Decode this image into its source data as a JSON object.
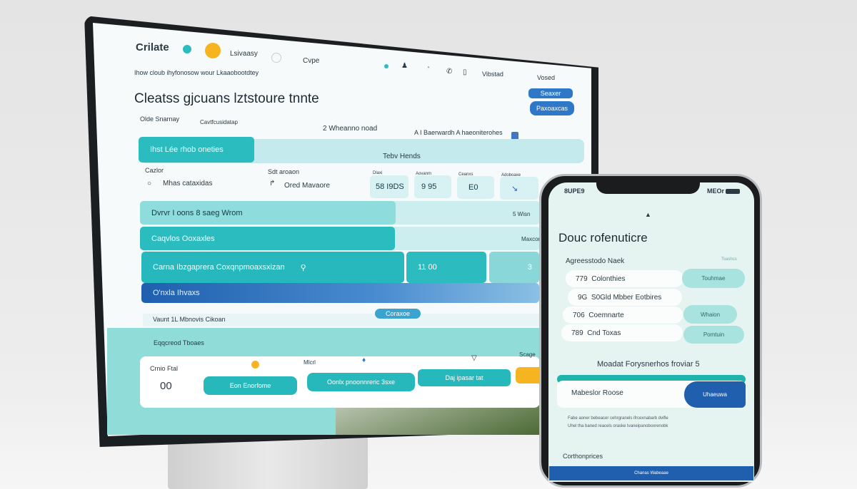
{
  "monitor": {
    "header": {
      "app_name": "Crilate",
      "nav": [
        "Lsivaasy",
        "Cvpe"
      ],
      "right": [
        "Vibstad",
        "Vosed"
      ]
    },
    "breadcrumb": "Ihow cloub ihyfonosow wour Lkaaobootdtey",
    "title": "Cleatss gjcuans lztstoure tnnte",
    "buttons": [
      "Seaxer",
      "Paxoaxcas"
    ],
    "meta": [
      "Olde Snarnay",
      "Cavtfcusidatap",
      "2 Wheanno noad",
      "A I Baerwardh A haeoniterohes"
    ],
    "tabs": [
      "Ihst Lée rhob oneties",
      "Tebv Hends"
    ],
    "labels": [
      "Cazlor",
      "Sdt aroaon"
    ],
    "items": [
      "Mhas cataxidas",
      "Ored Mavaore"
    ],
    "stats": [
      {
        "label": "Dlaxi",
        "value": "58 I9DS"
      },
      {
        "label": "Aovanm",
        "value": "9 95"
      },
      {
        "label": "Ceanxs",
        "value": "E0"
      },
      {
        "label": "Adoboaxe",
        "value": ""
      }
    ],
    "bars": [
      {
        "label": "Dvrvr I oons 8 saeg Wrom",
        "right": "5 Wisn"
      },
      {
        "label": "Caqvlos Ooxaxles",
        "right": "Maxcon"
      },
      {
        "label": "Carna Ibzgaprera Coxqnpmoaxsxizan",
        "value1": "11 00",
        "value2": "3"
      },
      {
        "label": "O'nxla Ihvaxs"
      }
    ],
    "footer_row": "Vaunt  1L Mbnovis Cikoan",
    "footer_button": "Coraxoe",
    "section_title": "Eqqcreod Tboaes",
    "card": {
      "label": "Crnio Ftal",
      "value": "00",
      "mid": "Mlcrl",
      "right": "Scage",
      "buttons": [
        "Eon Enorfome",
        "Oonlx pnoonnreric 3sxe",
        "Daj ipasar tat"
      ]
    }
  },
  "phone": {
    "status_left": "8UPE9",
    "status_right": "MEOr",
    "title": "Douc rofenuticre",
    "list_title": "Agreesstodo Naek",
    "list_link": "Tsashcs",
    "list": [
      {
        "num": "779",
        "label": "Colonthies",
        "pill": "Touhmae"
      },
      {
        "num": "9G",
        "label": "S0Gld Mbber Eotbires"
      },
      {
        "num": "706",
        "label": "Coemnarte",
        "pill": "Whaion"
      },
      {
        "num": "789",
        "label": "Cnd Toxas",
        "pill": "Pomtuin"
      }
    ],
    "subtitle": "Moadat Forysnerhos froviar 5",
    "card_label": "Mabeslor Roose",
    "card_button": "Uhaeuwa",
    "bullets": [
      "Fabe aoner bebeacer cehrgranels ifrcexnabarb dvifle",
      "Uhel tha baned reacels oraske tvaneipanoboxrenobk"
    ],
    "bottom_label": "Corthonprices",
    "footer": "Chanas Wabeaae"
  },
  "colors": {
    "teal": "#2bbcc0",
    "light_teal": "#bfe8ea",
    "blue": "#1f5fae",
    "orange": "#f6b520"
  }
}
